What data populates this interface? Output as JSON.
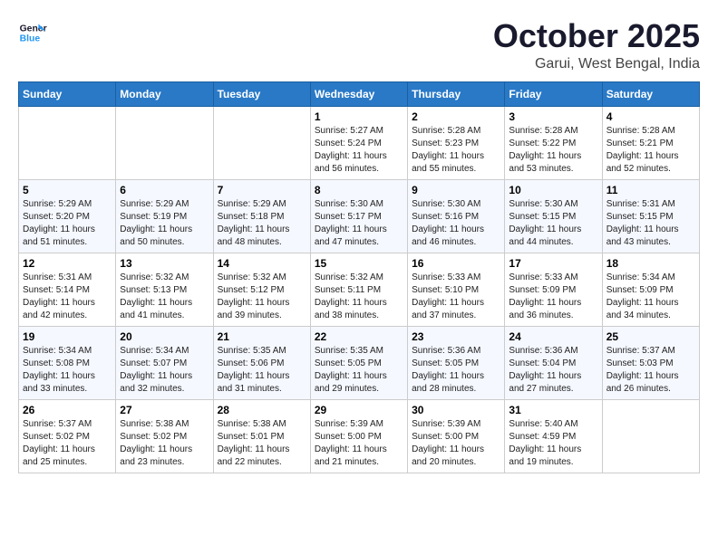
{
  "header": {
    "logo_line1": "General",
    "logo_line2": "Blue",
    "month_title": "October 2025",
    "location": "Garui, West Bengal, India"
  },
  "weekdays": [
    "Sunday",
    "Monday",
    "Tuesday",
    "Wednesday",
    "Thursday",
    "Friday",
    "Saturday"
  ],
  "weeks": [
    [
      {
        "day": "",
        "info": ""
      },
      {
        "day": "",
        "info": ""
      },
      {
        "day": "",
        "info": ""
      },
      {
        "day": "1",
        "info": "Sunrise: 5:27 AM\nSunset: 5:24 PM\nDaylight: 11 hours\nand 56 minutes."
      },
      {
        "day": "2",
        "info": "Sunrise: 5:28 AM\nSunset: 5:23 PM\nDaylight: 11 hours\nand 55 minutes."
      },
      {
        "day": "3",
        "info": "Sunrise: 5:28 AM\nSunset: 5:22 PM\nDaylight: 11 hours\nand 53 minutes."
      },
      {
        "day": "4",
        "info": "Sunrise: 5:28 AM\nSunset: 5:21 PM\nDaylight: 11 hours\nand 52 minutes."
      }
    ],
    [
      {
        "day": "5",
        "info": "Sunrise: 5:29 AM\nSunset: 5:20 PM\nDaylight: 11 hours\nand 51 minutes."
      },
      {
        "day": "6",
        "info": "Sunrise: 5:29 AM\nSunset: 5:19 PM\nDaylight: 11 hours\nand 50 minutes."
      },
      {
        "day": "7",
        "info": "Sunrise: 5:29 AM\nSunset: 5:18 PM\nDaylight: 11 hours\nand 48 minutes."
      },
      {
        "day": "8",
        "info": "Sunrise: 5:30 AM\nSunset: 5:17 PM\nDaylight: 11 hours\nand 47 minutes."
      },
      {
        "day": "9",
        "info": "Sunrise: 5:30 AM\nSunset: 5:16 PM\nDaylight: 11 hours\nand 46 minutes."
      },
      {
        "day": "10",
        "info": "Sunrise: 5:30 AM\nSunset: 5:15 PM\nDaylight: 11 hours\nand 44 minutes."
      },
      {
        "day": "11",
        "info": "Sunrise: 5:31 AM\nSunset: 5:15 PM\nDaylight: 11 hours\nand 43 minutes."
      }
    ],
    [
      {
        "day": "12",
        "info": "Sunrise: 5:31 AM\nSunset: 5:14 PM\nDaylight: 11 hours\nand 42 minutes."
      },
      {
        "day": "13",
        "info": "Sunrise: 5:32 AM\nSunset: 5:13 PM\nDaylight: 11 hours\nand 41 minutes."
      },
      {
        "day": "14",
        "info": "Sunrise: 5:32 AM\nSunset: 5:12 PM\nDaylight: 11 hours\nand 39 minutes."
      },
      {
        "day": "15",
        "info": "Sunrise: 5:32 AM\nSunset: 5:11 PM\nDaylight: 11 hours\nand 38 minutes."
      },
      {
        "day": "16",
        "info": "Sunrise: 5:33 AM\nSunset: 5:10 PM\nDaylight: 11 hours\nand 37 minutes."
      },
      {
        "day": "17",
        "info": "Sunrise: 5:33 AM\nSunset: 5:09 PM\nDaylight: 11 hours\nand 36 minutes."
      },
      {
        "day": "18",
        "info": "Sunrise: 5:34 AM\nSunset: 5:09 PM\nDaylight: 11 hours\nand 34 minutes."
      }
    ],
    [
      {
        "day": "19",
        "info": "Sunrise: 5:34 AM\nSunset: 5:08 PM\nDaylight: 11 hours\nand 33 minutes."
      },
      {
        "day": "20",
        "info": "Sunrise: 5:34 AM\nSunset: 5:07 PM\nDaylight: 11 hours\nand 32 minutes."
      },
      {
        "day": "21",
        "info": "Sunrise: 5:35 AM\nSunset: 5:06 PM\nDaylight: 11 hours\nand 31 minutes."
      },
      {
        "day": "22",
        "info": "Sunrise: 5:35 AM\nSunset: 5:05 PM\nDaylight: 11 hours\nand 29 minutes."
      },
      {
        "day": "23",
        "info": "Sunrise: 5:36 AM\nSunset: 5:05 PM\nDaylight: 11 hours\nand 28 minutes."
      },
      {
        "day": "24",
        "info": "Sunrise: 5:36 AM\nSunset: 5:04 PM\nDaylight: 11 hours\nand 27 minutes."
      },
      {
        "day": "25",
        "info": "Sunrise: 5:37 AM\nSunset: 5:03 PM\nDaylight: 11 hours\nand 26 minutes."
      }
    ],
    [
      {
        "day": "26",
        "info": "Sunrise: 5:37 AM\nSunset: 5:02 PM\nDaylight: 11 hours\nand 25 minutes."
      },
      {
        "day": "27",
        "info": "Sunrise: 5:38 AM\nSunset: 5:02 PM\nDaylight: 11 hours\nand 23 minutes."
      },
      {
        "day": "28",
        "info": "Sunrise: 5:38 AM\nSunset: 5:01 PM\nDaylight: 11 hours\nand 22 minutes."
      },
      {
        "day": "29",
        "info": "Sunrise: 5:39 AM\nSunset: 5:00 PM\nDaylight: 11 hours\nand 21 minutes."
      },
      {
        "day": "30",
        "info": "Sunrise: 5:39 AM\nSunset: 5:00 PM\nDaylight: 11 hours\nand 20 minutes."
      },
      {
        "day": "31",
        "info": "Sunrise: 5:40 AM\nSunset: 4:59 PM\nDaylight: 11 hours\nand 19 minutes."
      },
      {
        "day": "",
        "info": ""
      }
    ]
  ]
}
